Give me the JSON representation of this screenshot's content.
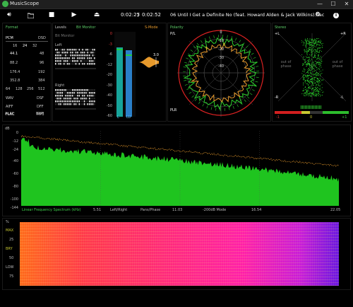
{
  "app": {
    "title": "MusicScope"
  },
  "window_controls": {
    "minimize": "—",
    "maximize": "☐",
    "close": "✕"
  },
  "toolbar": {
    "time_elapsed": "0:02:25",
    "time_sep": "/",
    "time_total": "0:02:52",
    "track": "06 Until I Get a Definite No (feat. Howard Alden & Jack Wilkins).flac"
  },
  "format": {
    "title": "Format",
    "pcm": "PCM",
    "dsd": "DSD",
    "bits": [
      "16",
      "24",
      "32"
    ],
    "rates": [
      [
        "44.1",
        "48"
      ],
      [
        "88.2",
        "96"
      ],
      [
        "176.4",
        "192"
      ],
      [
        "352.8",
        "384"
      ]
    ],
    "dsd_rates": [
      "64",
      "128",
      "256",
      "512"
    ],
    "formats": [
      [
        "WAV",
        "DSF"
      ],
      [
        "AIFF",
        "DFF"
      ],
      [
        "FLAC",
        "MP3"
      ],
      [
        "ALAC",
        "BWF"
      ]
    ]
  },
  "levels": {
    "title": "Levels",
    "subtitle": "Bit Monitor",
    "bitmonitor_label": "Bit Monitor",
    "left": "Left",
    "right": "Right",
    "smode": "S-Mode",
    "ticks": [
      "0",
      "-3",
      "-6",
      "-12",
      "-20",
      "-30",
      "-40",
      "-50",
      "-60"
    ],
    "peak_value": "3.0",
    "lr_left": "L",
    "lr_right": "LU",
    "level_left": 0.82,
    "level_right": 0.78
  },
  "polar": {
    "title": "Polarity",
    "pl": "P/L",
    "plr": "PLR",
    "rings": [
      "0",
      "-10",
      "-20",
      "-30",
      "-40"
    ]
  },
  "stereo": {
    "title": "Stereo",
    "l_pos": "+L",
    "r_pos": "+R",
    "l_neg": "-L",
    "r_neg": "-R",
    "out_phase_l": "out of phase",
    "out_phase_r": "out of phase",
    "corr_neg": "-1",
    "corr_zero": "0",
    "corr_pos": "+1"
  },
  "spectrum": {
    "ylabel": "dB",
    "yticks": [
      "0",
      "-12",
      "-24",
      "-40",
      "-60",
      "-80",
      "-100",
      "-144"
    ],
    "xticks": [
      "5.51",
      "11.03",
      "16.54",
      "22.05"
    ],
    "footer": [
      "Linear Frequency Spectrum (kHz)",
      "Left/Right",
      "Pans/Phase",
      "-200dB Mode"
    ],
    "colors": {
      "fill": "#1fc41f",
      "peak": "#e79a2c"
    }
  },
  "spectrogram": {
    "labels": [
      "%",
      "MAX",
      "25",
      "BRY",
      "50",
      "LOW",
      "75"
    ]
  }
}
